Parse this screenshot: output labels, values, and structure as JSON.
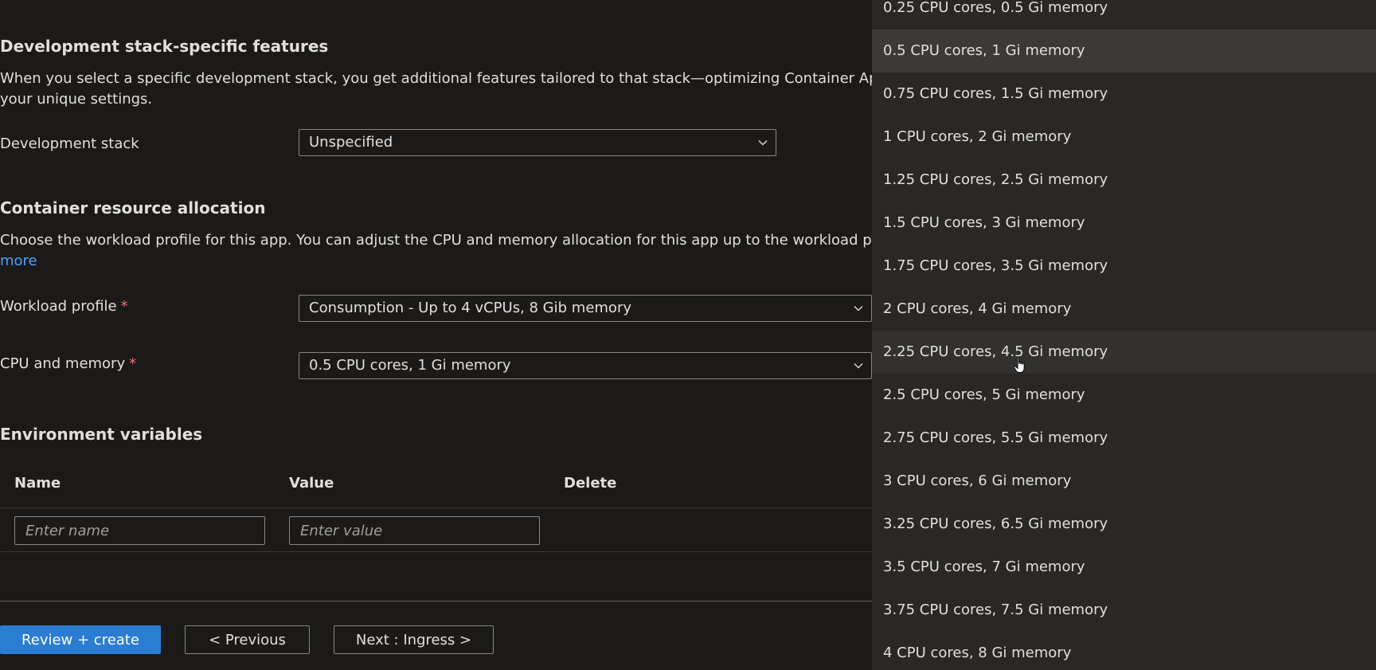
{
  "dev_stack_section": {
    "title": "Development stack-specific features",
    "desc_line1": "When you select a specific development stack, you get additional features tailored to that stack—optimizing Container Apps to",
    "desc_line2": "your unique settings.",
    "label": "Development stack",
    "value": "Unspecified"
  },
  "resource_section": {
    "title": "Container resource allocation",
    "desc_line1": "Choose the workload profile for this app. You can adjust the CPU and memory allocation for this app up to the workload profile",
    "learn_more": "more",
    "workload_label": "Workload profile",
    "workload_value": "Consumption - Up to 4 vCPUs, 8 Gib memory",
    "cpu_label": "CPU and memory",
    "cpu_value": "0.5 CPU cores, 1 Gi memory",
    "required_marker": "*"
  },
  "env_section": {
    "title": "Environment variables",
    "col_name": "Name",
    "col_value": "Value",
    "col_delete": "Delete",
    "name_placeholder": "Enter name",
    "value_placeholder": "Enter value"
  },
  "footer": {
    "review_create": "Review + create",
    "previous": "< Previous",
    "next": "Next : Ingress >"
  },
  "cpu_options": [
    "0.25 CPU cores, 0.5 Gi memory",
    "0.5 CPU cores, 1 Gi memory",
    "0.75 CPU cores, 1.5 Gi memory",
    "1 CPU cores, 2 Gi memory",
    "1.25 CPU cores, 2.5 Gi memory",
    "1.5 CPU cores, 3 Gi memory",
    "1.75 CPU cores, 3.5 Gi memory",
    "2 CPU cores, 4 Gi memory",
    "2.25 CPU cores, 4.5 Gi memory",
    "2.5 CPU cores, 5 Gi memory",
    "2.75 CPU cores, 5.5 Gi memory",
    "3 CPU cores, 6 Gi memory",
    "3.25 CPU cores, 6.5 Gi memory",
    "3.5 CPU cores, 7 Gi memory",
    "3.75 CPU cores, 7.5 Gi memory",
    "4 CPU cores, 8 Gi memory"
  ],
  "selected_option_index": 1,
  "hovered_option_index": 8,
  "colors": {
    "background": "#1b1a19",
    "menu_background": "#292827",
    "primary_button": "#2b7cd3",
    "link": "#4ea0ff",
    "required": "#f1707b"
  }
}
